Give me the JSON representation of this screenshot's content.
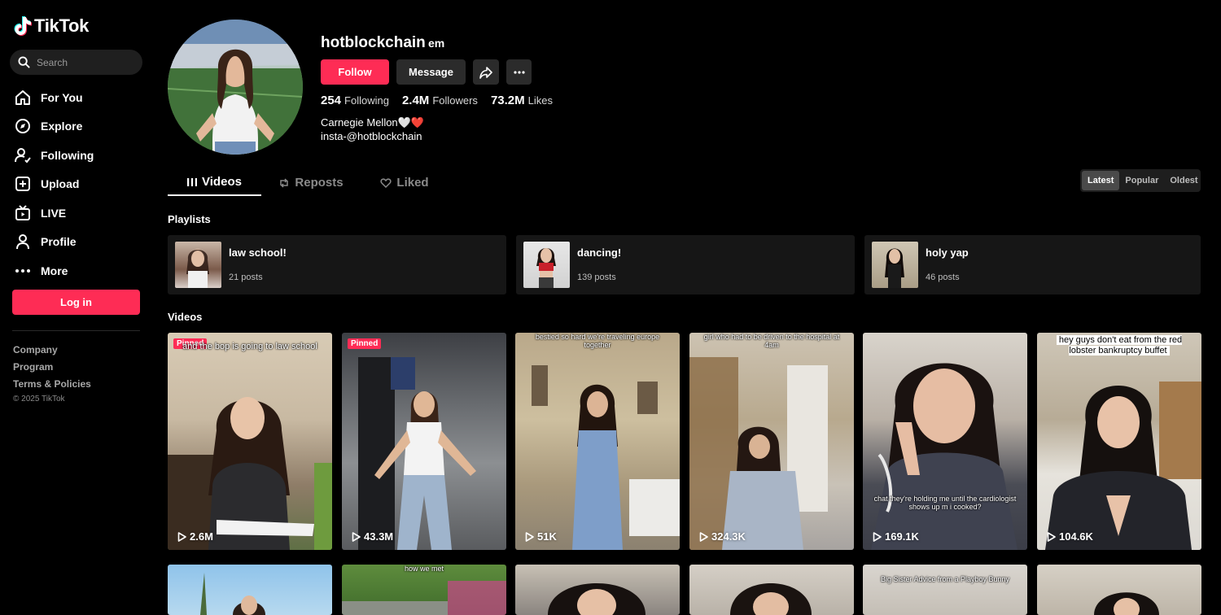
{
  "app": {
    "name": "TikTok"
  },
  "sidebar": {
    "search_placeholder": "Search",
    "nav": [
      {
        "label": "For You",
        "icon": "home-icon"
      },
      {
        "label": "Explore",
        "icon": "compass-icon"
      },
      {
        "label": "Following",
        "icon": "following-icon"
      },
      {
        "label": "Upload",
        "icon": "upload-icon"
      },
      {
        "label": "LIVE",
        "icon": "live-icon"
      },
      {
        "label": "Profile",
        "icon": "profile-icon"
      },
      {
        "label": "More",
        "icon": "more-icon"
      }
    ],
    "login_label": "Log in",
    "footer": [
      "Company",
      "Program",
      "Terms & Policies"
    ],
    "copyright": "© 2025 TikTok"
  },
  "profile": {
    "username": "hotblockchain",
    "nickname": "em",
    "follow_label": "Follow",
    "message_label": "Message",
    "stats": {
      "following_count": "254",
      "following_label": "Following",
      "followers_count": "2.4M",
      "followers_label": "Followers",
      "likes_count": "73.2M",
      "likes_label": "Likes"
    },
    "bio_line1": "Carnegie Mellon🤍❤️",
    "bio_line2": "insta-@hotblockchain"
  },
  "tabs": [
    {
      "label": "Videos",
      "active": true
    },
    {
      "label": "Reposts",
      "active": false
    },
    {
      "label": "Liked",
      "active": false
    }
  ],
  "sort": [
    {
      "label": "Latest",
      "active": true
    },
    {
      "label": "Popular",
      "active": false
    },
    {
      "label": "Oldest",
      "active": false
    }
  ],
  "playlists_title": "Playlists",
  "playlists": [
    {
      "name": "law school!",
      "count": "21 posts"
    },
    {
      "name": "dancing!",
      "count": "139 posts"
    },
    {
      "name": "holy yap",
      "count": "46 posts"
    }
  ],
  "videos_title": "Videos",
  "pinned_label": "Pinned",
  "videos": [
    {
      "views": "2.6M",
      "pinned": true,
      "caption": "and the bop is going to law school"
    },
    {
      "views": "43.3M",
      "pinned": true,
      "caption": ""
    },
    {
      "views": "51K",
      "pinned": false,
      "caption": "bestied so hard we're traveling europe together"
    },
    {
      "views": "324.3K",
      "pinned": false,
      "caption": "girl who had to be driven to the hospital at 4am"
    },
    {
      "views": "169.1K",
      "pinned": false,
      "caption": "chat they're holding me until the cardiologist shows up m i cooked?"
    },
    {
      "views": "104.6K",
      "pinned": false,
      "caption": "hey guys don't eat from the red lobster bankruptcy buffet"
    }
  ],
  "videos_row2": [
    {
      "caption": ""
    },
    {
      "caption": "how we met"
    },
    {
      "caption": ""
    },
    {
      "caption": ""
    },
    {
      "caption": "Big Sister Advice from a Playboy Bunny"
    },
    {
      "caption": ""
    }
  ]
}
